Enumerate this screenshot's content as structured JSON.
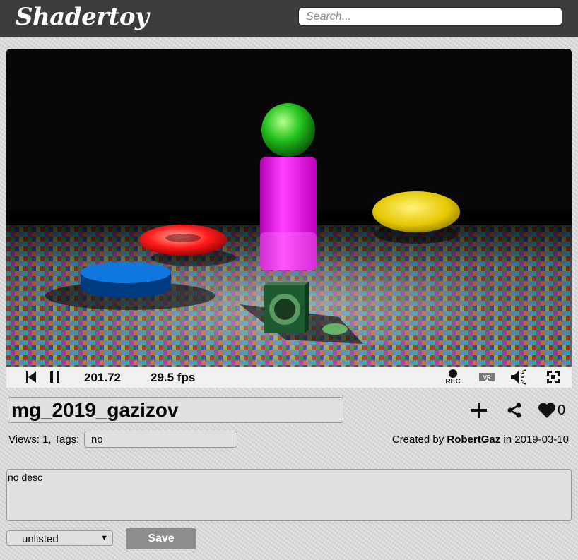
{
  "header": {
    "logo": "Shadertoy",
    "search_placeholder": "Search..."
  },
  "player": {
    "time": "201.72",
    "fps": "29.5 fps",
    "rec_label": "REC",
    "vr_label": "VR"
  },
  "shader": {
    "name": "mg_2019_gazizov",
    "likes": "0",
    "views_label": "Views: 1, Tags:",
    "tags": "no",
    "created_prefix": "Created by",
    "author": "RobertGaz",
    "date_prefix": "in",
    "date": "2019-03-10",
    "description": "no desc"
  },
  "form": {
    "privacy": "unlisted",
    "save_label": "Save"
  },
  "icons": {
    "restart": "skip-back-icon",
    "pause": "pause-icon",
    "record": "record-icon",
    "vr": "vr-icon",
    "volume": "volume-icon",
    "fullscreen": "fullscreen-icon",
    "add": "plus-icon",
    "share": "share-icon",
    "like": "heart-icon"
  }
}
